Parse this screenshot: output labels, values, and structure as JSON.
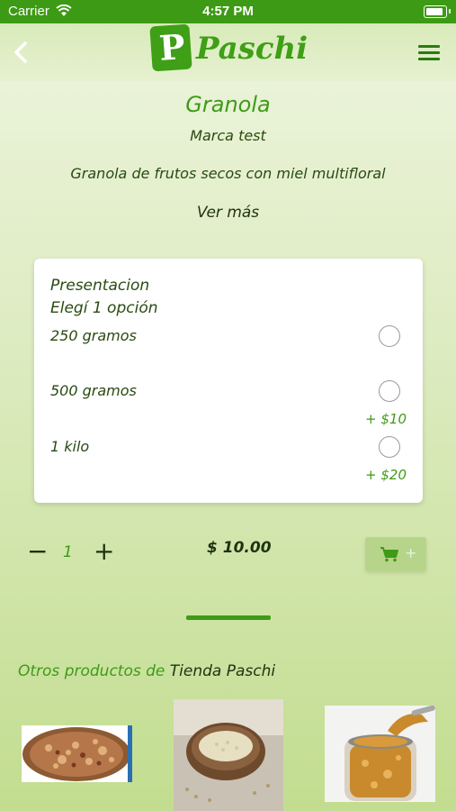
{
  "status_bar": {
    "carrier": "Carrier",
    "time": "4:57 PM"
  },
  "header": {
    "logo_text": "Paschi",
    "logo_mark": "P"
  },
  "product": {
    "title": "Granola",
    "brand": "Marca test",
    "description": "Granola de frutos secos con miel multifloral",
    "see_more": "Ver más"
  },
  "presentation": {
    "heading": "Presentacion",
    "instruction": "Elegí 1 opción",
    "options": [
      {
        "label": "250 gramos",
        "extra": ""
      },
      {
        "label": "500 gramos",
        "extra": "+ $10"
      },
      {
        "label": "1 kilo",
        "extra": "+ $20"
      }
    ]
  },
  "cart": {
    "minus": "−",
    "quantity": "1",
    "plus": "+",
    "price": "$ 10.00",
    "add_plus": "+"
  },
  "other_products": {
    "label": "Otros productos de",
    "store": "Tienda Paschi"
  },
  "colors": {
    "accent": "#3f9a18",
    "statusbar": "#3d9a14",
    "text_dark": "#1e3310"
  },
  "icons": [
    "back-chevron-icon",
    "hamburger-menu-icon",
    "cart-icon",
    "wifi-icon",
    "battery-icon"
  ]
}
